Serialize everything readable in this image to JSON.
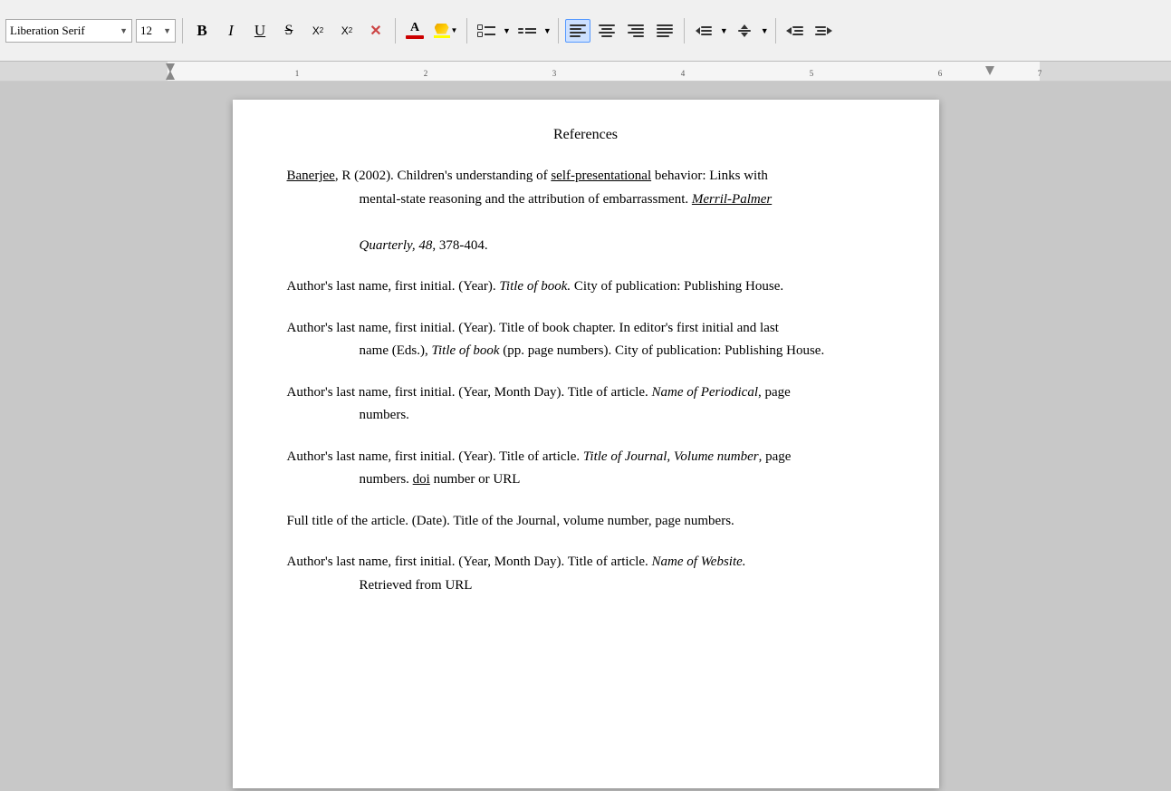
{
  "toolbar": {
    "font_name": "Liberation Serif",
    "font_size": "12",
    "bold_label": "B",
    "italic_label": "I",
    "underline_label": "U",
    "strikethrough_label": "S",
    "superscript_label": "X²",
    "subscript_label": "X₂",
    "clear_label": "✕",
    "font_color_letter": "A",
    "font_color_bar": "#cc0000",
    "highlight_color_bar": "#ffff00",
    "align_left_lines": [
      100,
      80,
      100,
      70,
      100
    ],
    "align_center_lines": [
      70,
      100,
      80,
      90,
      70
    ],
    "align_right_lines": [
      100,
      80,
      100,
      70,
      100
    ],
    "align_justify_lines": [
      100,
      100,
      100,
      100,
      80
    ]
  },
  "ruler": {
    "numbers": [
      "1",
      "2",
      "3",
      "4",
      "5",
      "6",
      "7"
    ],
    "positions": [
      330,
      470,
      615,
      757,
      900,
      1048,
      1190
    ]
  },
  "page": {
    "title": "References",
    "entries": [
      {
        "id": "entry1",
        "first_line": "Banerjee, R (2002). Children's understanding of self-presentational behavior: Links with",
        "continuation": "mental-state reasoning and the attribution of embarrassment. Merril-Palmer Quarterly, 48, 378-404.",
        "has_underline_banerjee": true,
        "has_underline_selfpres": true,
        "has_italic_journal": true
      },
      {
        "id": "entry2",
        "first_line": "Author's last name, first initial. (Year). Title of book. City of publication: Publishing House.",
        "continuation": null,
        "has_italic_title": true
      },
      {
        "id": "entry3",
        "first_line": "Author's last name, first initial. (Year). Title of book chapter. In editor's first initial and last",
        "continuation": "name (Eds.), Title of book (pp. page numbers). City of publication: Publishing House.",
        "has_italic_title": true
      },
      {
        "id": "entry4",
        "first_line": "Author's last name, first initial. (Year, Month Day). Title of article. Name of Periodical, page",
        "continuation": "numbers.",
        "has_italic_journal": true
      },
      {
        "id": "entry5",
        "first_line": "Author's last name, first initial. (Year). Title of article. Title of Journal, Volume number, page",
        "continuation": "numbers. doi number or URL",
        "has_italic_journal": true,
        "has_underline_doi": true
      },
      {
        "id": "entry6",
        "first_line": "Full title of the article. (Date). Title of the Journal, volume number, page numbers.",
        "continuation": null
      },
      {
        "id": "entry7",
        "first_line": "Author's last name, first initial. (Year, Month Day). Title of article. Name of Website.",
        "continuation": "Retrieved from URL",
        "has_italic_website": true
      }
    ]
  }
}
